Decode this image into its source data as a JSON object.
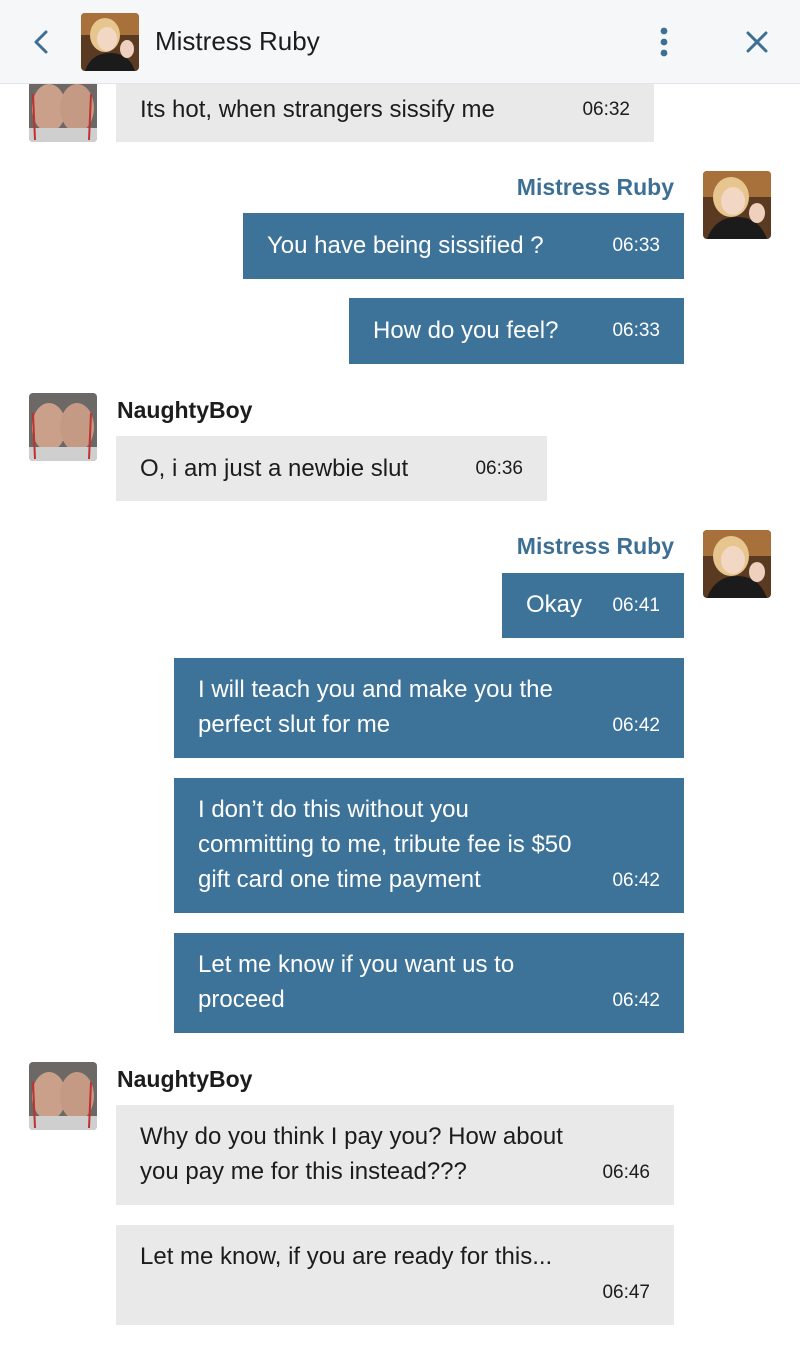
{
  "header": {
    "contact_name": "Mistress Ruby",
    "back_icon": "chevron-left-icon",
    "menu_icon": "more-vertical-icon",
    "close_icon": "close-icon"
  },
  "colors": {
    "outgoing_bubble": "#3d7299",
    "incoming_bubble": "#e9e9e9",
    "sender_accent": "#3d6f94"
  },
  "senders": {
    "me": "Mistress Ruby",
    "them": "NaughtyBoy"
  },
  "messages": [
    {
      "from": "them",
      "text": "Its hot, when strangers sissify me",
      "time": "06:32"
    },
    {
      "from": "me",
      "text": "You have being sissified ?",
      "time": "06:33"
    },
    {
      "from": "me",
      "text": "How do you feel?",
      "time": "06:33"
    },
    {
      "from": "them",
      "text": "O, i am just a newbie slut",
      "time": "06:36"
    },
    {
      "from": "me",
      "text": "Okay",
      "time": "06:41"
    },
    {
      "from": "me",
      "text": "I will teach you and make you the\nperfect slut for me",
      "time": "06:42"
    },
    {
      "from": "me",
      "text": "I don’t do this without you\ncommitting to me, tribute fee is $50\ngift card one time payment",
      "time": "06:42"
    },
    {
      "from": "me",
      "text": "Let me know if you want us to\nproceed",
      "time": "06:42"
    },
    {
      "from": "them",
      "text": "Why do you think I pay you? How about\nyou pay me for this instead???",
      "time": "06:46"
    },
    {
      "from": "them",
      "text": "Let me know, if you are ready for this...",
      "time": "06:47"
    }
  ]
}
